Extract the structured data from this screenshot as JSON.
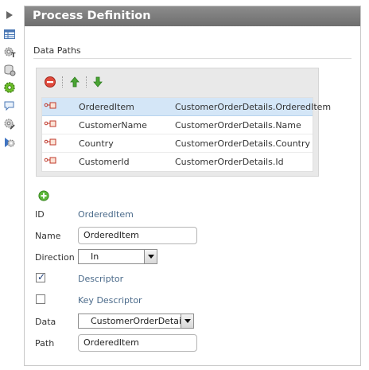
{
  "panel": {
    "title": "Process Definition"
  },
  "section": {
    "title": "Data Paths"
  },
  "table": {
    "rows": [
      {
        "name": "OrderedItem",
        "path": "CustomerOrderDetails.OrderedItem",
        "selected": true
      },
      {
        "name": "CustomerName",
        "path": "CustomerOrderDetails.Name",
        "selected": false
      },
      {
        "name": "Country",
        "path": "CustomerOrderDetails.Country",
        "selected": false
      },
      {
        "name": "CustomerId",
        "path": "CustomerOrderDetails.Id",
        "selected": false
      }
    ]
  },
  "form": {
    "id_label": "ID",
    "id_value": "OrderedItem",
    "name_label": "Name",
    "name_value": "OrderedItem",
    "direction_label": "Direction",
    "direction_value": "In",
    "descriptor_label": "Descriptor",
    "descriptor_checked": true,
    "key_descriptor_label": "Key Descriptor",
    "key_descriptor_checked": false,
    "data_label": "Data",
    "data_value": "CustomerOrderDetails",
    "path_label": "Path",
    "path_value": "OrderedItem"
  },
  "icons": {
    "toolbar": [
      "expand-arrow-icon",
      "table-icon",
      "gear-text-icon",
      "database-icon",
      "gear-green-icon",
      "speech-bubble-icon",
      "gear-pencil-icon",
      "gear-arrow-icon"
    ],
    "grid_toolbar": [
      "remove-icon",
      "move-up-icon",
      "move-down-icon"
    ],
    "add": "add-icon",
    "row": "data-path-icon"
  },
  "colors": {
    "header_bg": "#7c7c7c",
    "selected_row": "#d4e6f7",
    "value_text": "#4a6a8a",
    "remove_red": "#d9382c",
    "arrow_green": "#3a9a2a"
  }
}
